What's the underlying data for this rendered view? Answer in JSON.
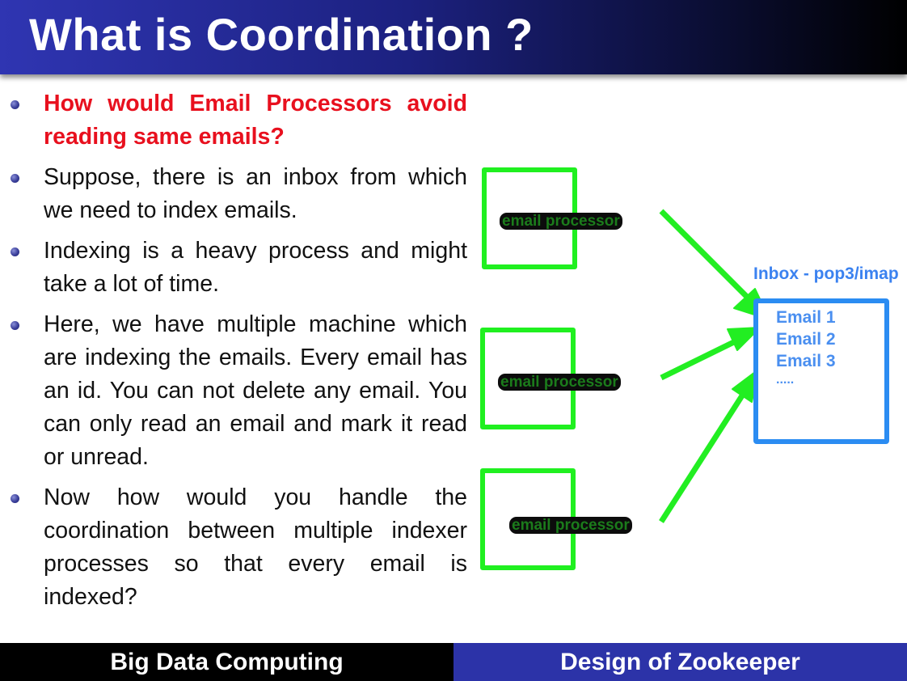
{
  "slide": {
    "title": "What is Coordination ?",
    "bullets": [
      "How would Email Processors avoid reading same emails?",
      "Suppose, there is an inbox from which we need to index emails.",
      "Indexing is a heavy process and might take a lot of time.",
      "Here, we  have multiple machine which are indexing the emails.  Every email has an id. You can not delete any email. You can only read an email and mark it read or unread.",
      "Now how would you handle the coordination between multiple indexer processes so that every email is indexed?"
    ]
  },
  "diagram": {
    "processors": [
      "email processor",
      "email processor",
      "email processor"
    ],
    "inbox_title": "Inbox - pop3/imap",
    "inbox_items": [
      "Email 1",
      "Email 2",
      "Email 3",
      "....."
    ],
    "colors": {
      "processor": "#20f020",
      "inbox": "#2b8cf2",
      "arrow": "#22ee22"
    }
  },
  "footer": {
    "left": "Big Data Computing",
    "right": "Design of Zookeeper"
  },
  "colors": {
    "highlight": "#e8101e",
    "header_start": "#2f35b2",
    "footer_right": "#2c33a8"
  }
}
